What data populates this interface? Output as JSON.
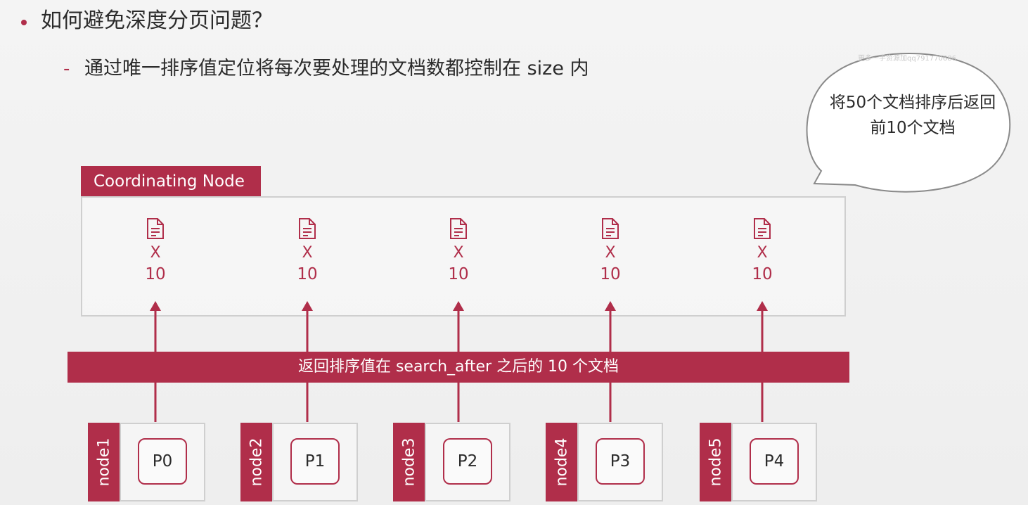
{
  "heading": "如何避免深度分页问题？",
  "subpoint": {
    "dash": "-",
    "text": "通过唯一排序值定位将每次要处理的文档数都控制在 size 内"
  },
  "bubble": {
    "watermark": "更多一手资源加qq791770686",
    "line1": "将50个文档排序后返回",
    "line2": "前10个文档"
  },
  "coordinating_node": {
    "label": "Coordinating Node",
    "docs": [
      {
        "x": "X",
        "count": "10"
      },
      {
        "x": "X",
        "count": "10"
      },
      {
        "x": "X",
        "count": "10"
      },
      {
        "x": "X",
        "count": "10"
      },
      {
        "x": "X",
        "count": "10"
      }
    ]
  },
  "banner": "返回排序值在 search_after 之后的 10 个文档",
  "nodes": [
    {
      "name": "node1",
      "shard": "P0"
    },
    {
      "name": "node2",
      "shard": "P1"
    },
    {
      "name": "node3",
      "shard": "P2"
    },
    {
      "name": "node4",
      "shard": "P3"
    },
    {
      "name": "node5",
      "shard": "P4"
    }
  ],
  "colors": {
    "accent": "#b02e4a",
    "border": "#cfcfcf",
    "text": "#2b2b2b"
  }
}
